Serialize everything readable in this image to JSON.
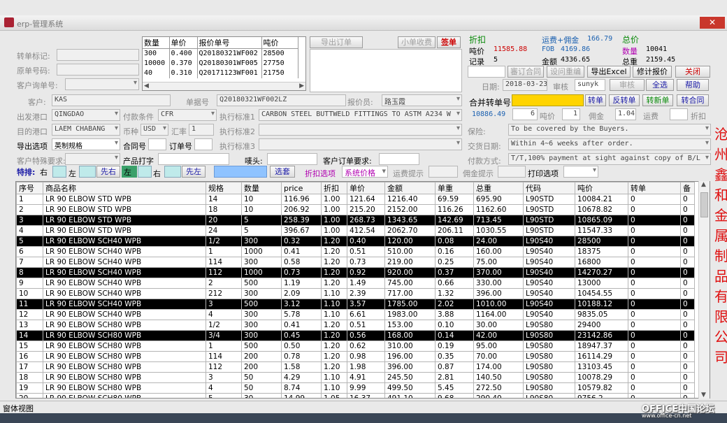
{
  "window": {
    "title": "erp-管理系统",
    "close": "✕"
  },
  "header_left": {
    "transfer_mark_label": "转单标记:",
    "orig_no_label": "原单号码:",
    "cust_inquiry_label": "客户询单号:"
  },
  "mini_grid": {
    "headers": [
      "数量",
      "单价",
      "报价单号",
      "吨价"
    ],
    "rows": [
      [
        "300",
        "0.400",
        "Q20180321WF002",
        "28500"
      ],
      [
        "10000",
        "0.370",
        "Q20180301WF005",
        "27750"
      ],
      [
        "40",
        "0.310",
        "Q20171123WF001",
        "21750"
      ]
    ]
  },
  "top_buttons": {
    "export_order": "导出订单",
    "small_profit": "小单收费",
    "sign": "签单"
  },
  "summary": {
    "discount_label": "折扣",
    "ton_price_label": "吨价",
    "ton_price": "11585.88",
    "records_label": "记录",
    "records": "5",
    "freight_label": "运费+佣金",
    "freight": "166.79",
    "fob_label": "FOB",
    "fob": "4169.86",
    "amount_label": "金额",
    "amount": "4336.65",
    "total_price_label": "总价",
    "qty_label": "数量",
    "qty": "10041",
    "weight_label": "总重",
    "weight": "2159.45"
  },
  "action_buttons": {
    "review_contract": "審订合同",
    "review_inquiry": "设问重编",
    "export_excel": "导出Excel",
    "revise_quote": "修计报价",
    "close": "关闭",
    "audit": "审核",
    "select_all": "全选",
    "help": "帮助"
  },
  "date_label": "日期:",
  "date": "2018-03-23",
  "reviewer_label": "审核",
  "reviewer": "sunyk",
  "customer": {
    "label": "客户:",
    "value": "KAS"
  },
  "doc_no": {
    "label": "单据号",
    "value": "Q20180321WF002LZ"
  },
  "quoter": {
    "label": "报价员:",
    "value": "路玉霞"
  },
  "merge": {
    "label": "合并转单号",
    "transfer": "转单",
    "reverse": "反转单",
    "new": "转新单",
    "contract": "转合同"
  },
  "calc_row": {
    "value1": "10886.49",
    "value2": "6",
    "ton_label": "吨价",
    "ton": "1",
    "commission_label": "佣金",
    "commission": "1.04",
    "freight_label": "运费",
    "discount_label": "折扣"
  },
  "ports": {
    "from_label": "出发港口",
    "from": "QINGDAO",
    "to_label": "目的港口",
    "to": "LAEM CHABANG",
    "terms_label": "付款条件",
    "terms": "CFR",
    "currency_label": "币种",
    "currency": "USD",
    "rate_label": "汇率",
    "rate": "1"
  },
  "standards": {
    "s1_label": "执行标准1",
    "s1": "CARBON STEEL BUTTWELD FITTINGS TO ASTM A234 W",
    "s2_label": "执行标准2",
    "s3_label": "执行标准3"
  },
  "right_terms": {
    "insurance_label": "保险:",
    "insurance": "To be covered by the Buyers.",
    "delivery_label": "交货日期:",
    "delivery": "Within 4~6 weeks after order.",
    "payment_label": "付款方式:",
    "payment": "T/T,100% payment at sight against copy of B/L"
  },
  "export_option": {
    "label": "导出选项",
    "value": "英制规格",
    "contract_label": "合同号",
    "order_label": "订单号"
  },
  "special_req_label": "客户特殊要求:",
  "product_print_label": "产品打字",
  "mark_label": "唛头:",
  "cust_order_req_label": "客户订单要求:",
  "special_bar": {
    "label": "特排:",
    "right": "右",
    "left": "左",
    "first_right": "先右",
    "left2": "左",
    "right2": "右",
    "first_left": "先左",
    "choose": "选套",
    "discount_opt": "折扣选项",
    "sys_price": "系统价格",
    "freight_hint": "运费提示",
    "commission_hint": "佣金提示",
    "print_opt": "打印选项"
  },
  "table": {
    "headers": [
      "序号",
      "商品名称",
      "规格",
      "数量",
      "price",
      "折扣",
      "单价",
      "金额",
      "单重",
      "总重",
      "代码",
      "吨价",
      "转单",
      "备"
    ],
    "rows": [
      [
        "1",
        "LR 90 ELBOW STD WPB",
        "14",
        "10",
        "116.96",
        "1.00",
        "121.64",
        "1216.40",
        "69.59",
        "695.90",
        "L90STD",
        "10084.21",
        "0",
        "0"
      ],
      [
        "2",
        "LR 90 ELBOW STD WPB",
        "18",
        "10",
        "206.92",
        "1.00",
        "215.20",
        "2152.00",
        "116.26",
        "1162.60",
        "L90STD",
        "10678.82",
        "0",
        "0"
      ],
      [
        "3",
        "LR 90 ELBOW STD WPB",
        "20",
        "5",
        "258.39",
        "1.00",
        "268.73",
        "1343.65",
        "142.69",
        "713.45",
        "L90STD",
        "10865.09",
        "0",
        "0"
      ],
      [
        "4",
        "LR 90 ELBOW STD WPB",
        "24",
        "5",
        "396.67",
        "1.00",
        "412.54",
        "2062.70",
        "206.11",
        "1030.55",
        "L90STD",
        "11547.33",
        "0",
        "0"
      ],
      [
        "5",
        "LR 90 ELBOW SCH40 WPB",
        "1/2",
        "300",
        "0.32",
        "1.20",
        "0.40",
        "120.00",
        "0.08",
        "24.00",
        "L90S40",
        "28500",
        "0",
        "0"
      ],
      [
        "6",
        "LR 90 ELBOW SCH40 WPB",
        "1",
        "1000",
        "0.41",
        "1.20",
        "0.51",
        "510.00",
        "0.16",
        "160.00",
        "L90S40",
        "18375",
        "0",
        "0"
      ],
      [
        "7",
        "LR 90 ELBOW SCH40 WPB",
        "114",
        "300",
        "0.58",
        "1.20",
        "0.73",
        "219.00",
        "0.25",
        "75.00",
        "L90S40",
        "16800",
        "0",
        "0"
      ],
      [
        "8",
        "LR 90 ELBOW SCH40 WPB",
        "112",
        "1000",
        "0.73",
        "1.20",
        "0.92",
        "920.00",
        "0.37",
        "370.00",
        "L90S40",
        "14270.27",
        "0",
        "0"
      ],
      [
        "9",
        "LR 90 ELBOW SCH40 WPB",
        "2",
        "500",
        "1.19",
        "1.20",
        "1.49",
        "745.00",
        "0.66",
        "330.00",
        "L90S40",
        "13000",
        "0",
        "0"
      ],
      [
        "10",
        "LR 90 ELBOW SCH40 WPB",
        "212",
        "300",
        "2.09",
        "1.10",
        "2.39",
        "717.00",
        "1.32",
        "396.00",
        "L90S40",
        "10454.55",
        "0",
        "0"
      ],
      [
        "11",
        "LR 90 ELBOW SCH40 WPB",
        "3",
        "500",
        "3.12",
        "1.10",
        "3.57",
        "1785.00",
        "2.02",
        "1010.00",
        "L90S40",
        "10188.12",
        "0",
        "0"
      ],
      [
        "12",
        "LR 90 ELBOW SCH40 WPB",
        "4",
        "300",
        "5.78",
        "1.10",
        "6.61",
        "1983.00",
        "3.88",
        "1164.00",
        "L90S40",
        "9835.05",
        "0",
        "0"
      ],
      [
        "13",
        "LR 90 ELBOW SCH80 WPB",
        "1/2",
        "300",
        "0.41",
        "1.20",
        "0.51",
        "153.00",
        "0.10",
        "30.00",
        "L90S80",
        "29400",
        "0",
        "0"
      ],
      [
        "14",
        "LR 90 ELBOW SCH80 WPB",
        "3/4",
        "300",
        "0.45",
        "1.20",
        "0.56",
        "168.00",
        "0.14",
        "42.00",
        "L90S80",
        "23142.86",
        "0",
        "0"
      ],
      [
        "15",
        "LR 90 ELBOW SCH80 WPB",
        "1",
        "500",
        "0.50",
        "1.20",
        "0.62",
        "310.00",
        "0.19",
        "95.00",
        "L90S80",
        "18947.37",
        "0",
        "0"
      ],
      [
        "16",
        "LR 90 ELBOW SCH80 WPB",
        "114",
        "200",
        "0.78",
        "1.20",
        "0.98",
        "196.00",
        "0.35",
        "70.00",
        "L90S80",
        "16114.29",
        "0",
        "0"
      ],
      [
        "17",
        "LR 90 ELBOW SCH80 WPB",
        "112",
        "200",
        "1.58",
        "1.20",
        "1.98",
        "396.00",
        "0.87",
        "174.00",
        "L90S80",
        "13103.45",
        "0",
        "0"
      ],
      [
        "18",
        "LR 90 ELBOW SCH80 WPB",
        "3",
        "50",
        "4.29",
        "1.10",
        "4.91",
        "245.50",
        "2.81",
        "140.50",
        "L90S80",
        "10078.29",
        "0",
        "0"
      ],
      [
        "19",
        "LR 90 ELBOW SCH80 WPB",
        "4",
        "50",
        "8.74",
        "1.10",
        "9.99",
        "499.50",
        "5.45",
        "272.50",
        "L90S80",
        "10579.82",
        "0",
        "0"
      ],
      [
        "20",
        "LR 90 ELBOW SCH80 WPB",
        "5",
        "30",
        "14.99",
        "1.05",
        "16.37",
        "491.10",
        "9.68",
        "290.40",
        "L90S80",
        "9756.2",
        "0",
        "0"
      ]
    ],
    "selected_rows": [
      2,
      4,
      7,
      10,
      13
    ]
  },
  "status": {
    "text": "窗体视图"
  },
  "side_text": [
    "沧",
    "州",
    "鑫",
    "和",
    "金",
    "属",
    "制",
    "品",
    "有",
    "限",
    "公",
    "司"
  ],
  "watermark": {
    "main": "OFFICE中国论坛",
    "sub": "www.office-cn.net"
  }
}
